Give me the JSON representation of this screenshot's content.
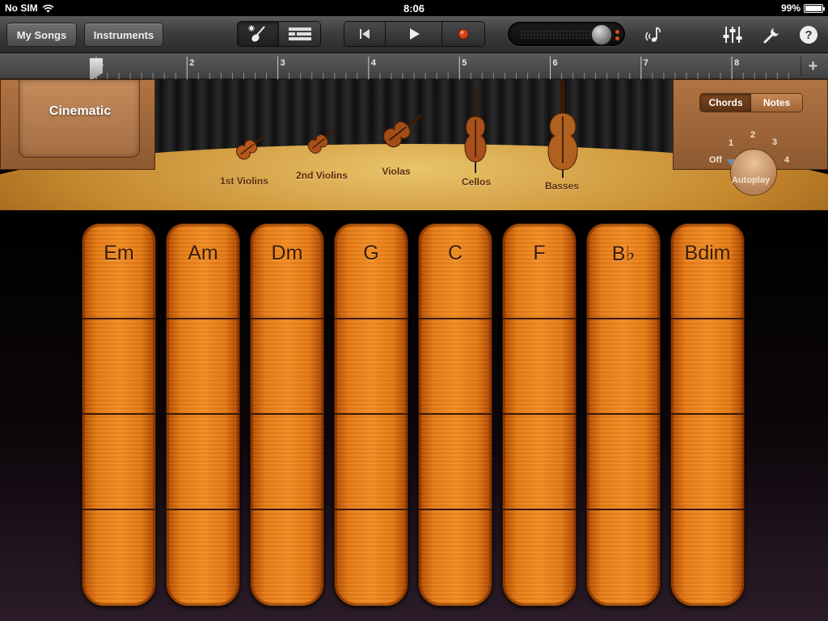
{
  "status_bar": {
    "carrier": "No SIM",
    "time": "8:06",
    "battery": "99%",
    "battery_level": 0.99
  },
  "toolbar": {
    "my_songs_label": "My Songs",
    "instruments_label": "Instruments",
    "view_icons": [
      "smart-instrument-icon",
      "tracks-view-icon"
    ],
    "transport_icons": [
      "go-to-beginning-icon",
      "play-icon",
      "record-icon"
    ],
    "right_icons": [
      "metronome-icon",
      "mixer-icon",
      "wrench-icon",
      "help-icon"
    ],
    "help_glyph": "?"
  },
  "ruler": {
    "bars": [
      "1",
      "2",
      "3",
      "4",
      "5",
      "6",
      "7",
      "8"
    ],
    "add_glyph": "+"
  },
  "stage": {
    "instrument_name": "Cinematic",
    "sections": [
      "1st Violins",
      "2nd Violins",
      "Violas",
      "Cellos",
      "Basses"
    ],
    "mode_options": [
      "Chords",
      "Notes"
    ],
    "mode_selected": "Chords",
    "autoplay": {
      "label": "Autoplay",
      "positions": [
        "Off",
        "1",
        "2",
        "3",
        "4"
      ],
      "selected": "Off"
    }
  },
  "chords": [
    "Em",
    "Am",
    "Dm",
    "G",
    "C",
    "F",
    "B♭",
    "Bdim"
  ],
  "colors": {
    "strip": "#f28c22",
    "stage_wood": "#c4862b",
    "record": "#e04a1a"
  }
}
